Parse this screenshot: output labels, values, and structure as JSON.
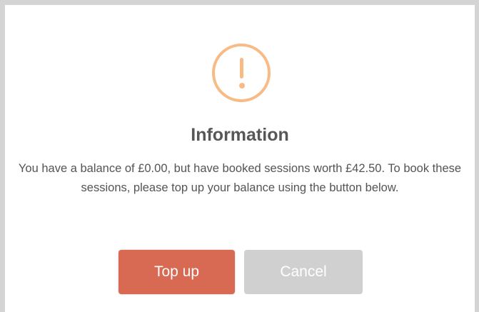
{
  "dialog": {
    "title": "Information",
    "message": "You have a balance of £0.00, but have booked sessions worth £42.50. To book these sessions, please top up your balance using the button below.",
    "icon": "exclamation-circle-icon",
    "accent_color": "#f8bb86",
    "buttons": {
      "confirm_label": "Top up",
      "confirm_color": "#d86a53",
      "cancel_label": "Cancel",
      "cancel_color": "#d0d0d0"
    }
  }
}
